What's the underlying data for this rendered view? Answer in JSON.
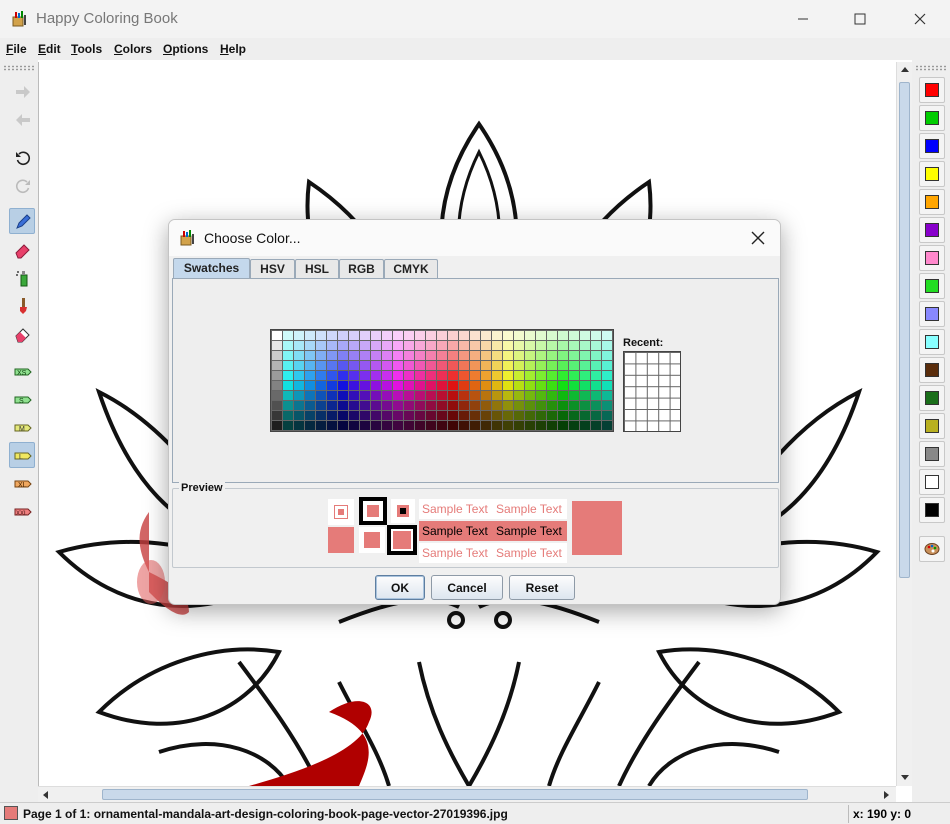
{
  "window": {
    "title": "Happy Coloring Book"
  },
  "menu": [
    "File",
    "Edit",
    "Tools",
    "Colors",
    "Options",
    "Help"
  ],
  "left_toolbar": [
    {
      "name": "redo-arrow-icon",
      "active": false
    },
    {
      "name": "undo-arrow-icon",
      "active": false
    },
    {
      "name": "rotate-left-icon",
      "active": false
    },
    {
      "name": "rotate-right-icon",
      "active": false
    },
    {
      "name": "pen-icon",
      "active": true
    },
    {
      "name": "eraser-icon",
      "active": false
    },
    {
      "name": "spray-icon",
      "active": false
    },
    {
      "name": "brush-icon",
      "active": false
    },
    {
      "name": "fill-eraser-icon",
      "active": false
    },
    {
      "name": "brush-size-xs-icon",
      "label": "XS",
      "active": false
    },
    {
      "name": "brush-size-s-icon",
      "label": "S",
      "active": false
    },
    {
      "name": "brush-size-m-icon",
      "label": "M",
      "active": false
    },
    {
      "name": "brush-size-l-icon",
      "label": "L",
      "active": true
    },
    {
      "name": "brush-size-xl-icon",
      "label": "XL",
      "active": false
    },
    {
      "name": "brush-size-xxl-icon",
      "label": "XXL",
      "active": false
    }
  ],
  "palette": [
    "#ff0000",
    "#00cc00",
    "#0000ff",
    "#ffff00",
    "#ffa500",
    "#8800cc",
    "#ff88cc",
    "#22dd22",
    "#8888ff",
    "#88ffff",
    "#5a2d0c",
    "#1a6e1a",
    "#b8b020",
    "#888888",
    "#ffffff",
    "#000000"
  ],
  "status": {
    "current_color": "#e57b79",
    "page_text": "Page 1 of 1: ornamental-mandala-art-design-coloring-book-page-vector-27019396.jpg",
    "coords": "x:  190 y:   0"
  },
  "dialog": {
    "title": "Choose Color...",
    "tabs": [
      "Swatches",
      "HSV",
      "HSL",
      "RGB",
      "CMYK"
    ],
    "active_tab": "Swatches",
    "recent_label": "Recent:",
    "preview_label": "Preview",
    "sample_text": "Sample Text",
    "selected_color": "#e57b79",
    "buttons": {
      "ok": "OK",
      "cancel": "Cancel",
      "reset": "Reset"
    }
  }
}
